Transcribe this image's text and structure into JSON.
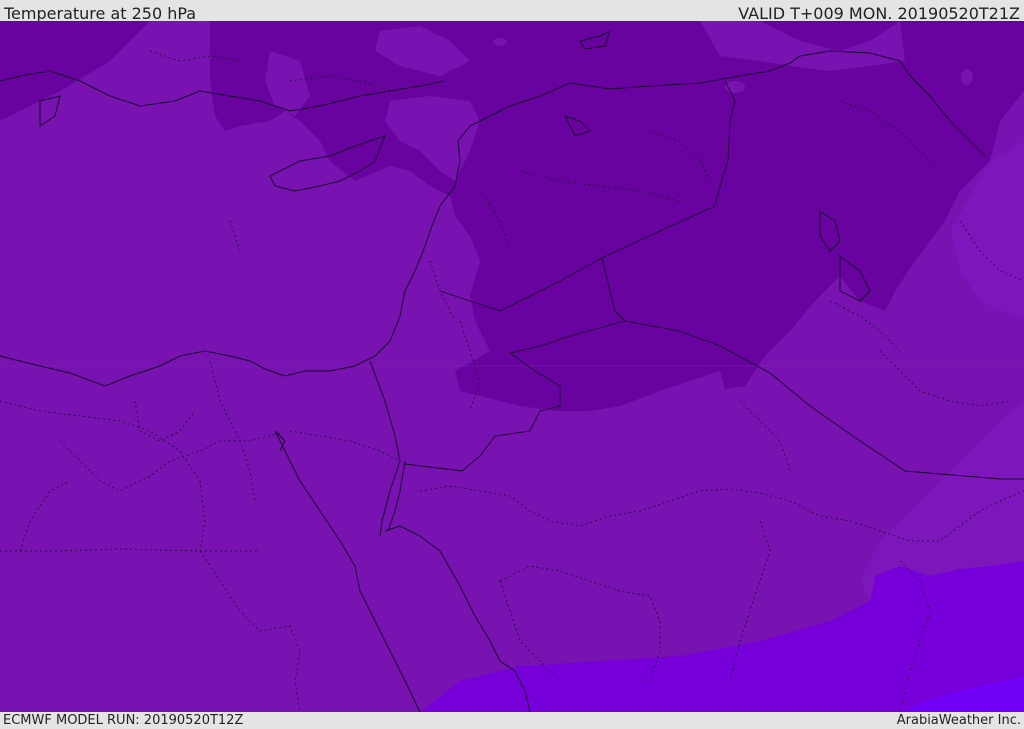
{
  "header": {
    "title": "Temperature at 250 hPa",
    "valid": "VALID T+009 MON. 20190520T21Z"
  },
  "footer": {
    "model_run": "ECMWF MODEL RUN: 20190520T12Z",
    "credit": "ArabiaWeather Inc."
  },
  "map": {
    "colors": {
      "base_purple": "#7812b0",
      "dark_purple": "#69039f",
      "light_purple": "#7d17bc",
      "violet": "#7700da",
      "bright_violet": "#7200f6",
      "border_line": "#1a0830"
    }
  }
}
